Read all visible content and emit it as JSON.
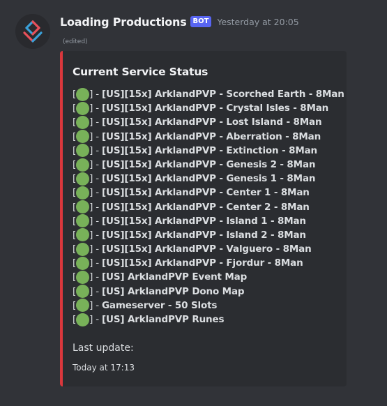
{
  "message": {
    "author": "Loading Productions",
    "bot_tag": "BOT",
    "timestamp": "Yesterday at 20:05",
    "edited_label": "(edited)",
    "avatar_icon": "shield-logo-icon"
  },
  "embed": {
    "accent_color": "#da373c",
    "title": "Current Service Status",
    "status_color": "#78b159",
    "servers": [
      {
        "name": "[US][15x] ArklandPVP - Scorched Earth - 8Man",
        "status": "online"
      },
      {
        "name": "[US][15x] ArklandPVP - Crystal Isles - 8Man",
        "status": "online"
      },
      {
        "name": "[US][15x] ArklandPVP - Lost Island - 8Man",
        "status": "online"
      },
      {
        "name": "[US][15x] ArklandPVP - Aberration - 8Man",
        "status": "online"
      },
      {
        "name": "[US][15x] ArklandPVP - Extinction - 8Man",
        "status": "online"
      },
      {
        "name": "[US][15x] ArklandPVP - Genesis 2 - 8Man",
        "status": "online"
      },
      {
        "name": "[US][15x] ArklandPVP - Genesis 1 - 8Man",
        "status": "online"
      },
      {
        "name": "[US][15x] ArklandPVP - Center 1 - 8Man",
        "status": "online"
      },
      {
        "name": "[US][15x] ArklandPVP - Center 2 - 8Man",
        "status": "online"
      },
      {
        "name": "[US][15x] ArklandPVP - Island 1 - 8Man",
        "status": "online"
      },
      {
        "name": "[US][15x] ArklandPVP - Island 2 - 8Man",
        "status": "online"
      },
      {
        "name": "[US][15x] ArklandPVP - Valguero - 8Man",
        "status": "online"
      },
      {
        "name": "[US][15x] ArklandPVP - Fjordur - 8Man",
        "status": "online"
      },
      {
        "name": "[US] ArklandPVP Event Map",
        "status": "online"
      },
      {
        "name": "[US] ArklandPVP Dono Map",
        "status": "online"
      },
      {
        "name": "Gameserver - 50 Slots",
        "status": "online"
      },
      {
        "name": "[US] ArklandPVP Runes",
        "status": "online"
      }
    ],
    "last_update_label": "Last update:",
    "last_update_time": "Today at 17:13"
  }
}
